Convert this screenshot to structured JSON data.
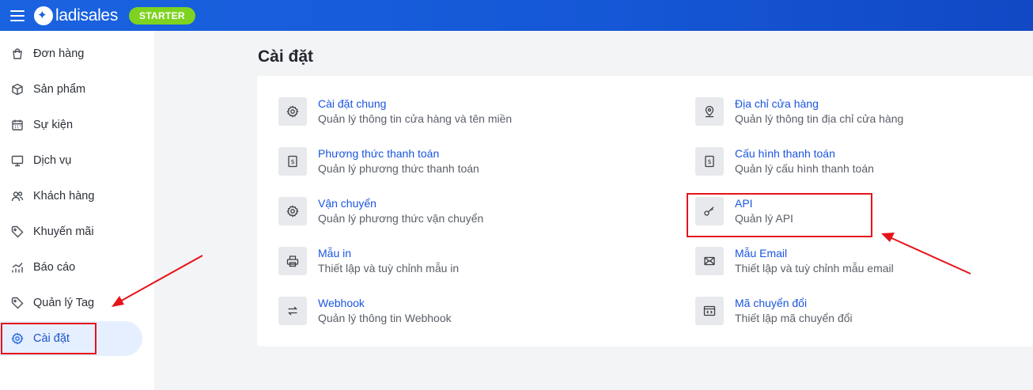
{
  "topbar": {
    "logo_text": "ladisales",
    "plan_badge": "STARTER"
  },
  "sidebar": {
    "items": [
      {
        "label": "Đơn hàng",
        "icon": "shopping-bag-icon"
      },
      {
        "label": "Sản phẩm",
        "icon": "box-icon"
      },
      {
        "label": "Sự kiện",
        "icon": "calendar-icon"
      },
      {
        "label": "Dịch vụ",
        "icon": "monitor-icon"
      },
      {
        "label": "Khách hàng",
        "icon": "users-icon"
      },
      {
        "label": "Khuyến mãi",
        "icon": "tag-icon"
      },
      {
        "label": "Báo cáo",
        "icon": "chart-icon"
      },
      {
        "label": "Quản lý Tag",
        "icon": "tag-icon"
      },
      {
        "label": "Cài đặt",
        "icon": "gear-icon",
        "active": true
      }
    ]
  },
  "page": {
    "title": "Cài đặt"
  },
  "settings": {
    "left": [
      {
        "title": "Cài đặt chung",
        "desc": "Quản lý thông tin cửa hàng và tên miền",
        "icon": "gear-icon"
      },
      {
        "title": "Phương thức thanh toán",
        "desc": "Quản lý phương thức thanh toán",
        "icon": "payment-icon"
      },
      {
        "title": "Vận chuyển",
        "desc": "Quản lý phương thức vận chuyển",
        "icon": "gear-icon"
      },
      {
        "title": "Mẫu in",
        "desc": "Thiết lập và tuỳ chỉnh mẫu in",
        "icon": "printer-icon"
      },
      {
        "title": "Webhook",
        "desc": "Quản lý thông tin Webhook",
        "icon": "swap-icon"
      }
    ],
    "right": [
      {
        "title": "Địa chỉ cửa hàng",
        "desc": "Quản lý thông tin địa chỉ cửa hàng",
        "icon": "location-pin-icon"
      },
      {
        "title": "Cấu hình thanh toán",
        "desc": "Quản lý cấu hình thanh toán",
        "icon": "payment-icon"
      },
      {
        "title": "API",
        "desc": "Quản lý API",
        "icon": "key-icon"
      },
      {
        "title": "Mẫu Email",
        "desc": "Thiết lập và tuỳ chỉnh mẫu email",
        "icon": "mail-icon"
      },
      {
        "title": "Mã chuyển đổi",
        "desc": "Thiết lập mã chuyển đổi",
        "icon": "code-icon"
      }
    ]
  },
  "colors": {
    "topbar": "#1a63e0",
    "badge": "#7ed321",
    "link": "#1a55e0",
    "annotation": "#e5141a"
  }
}
